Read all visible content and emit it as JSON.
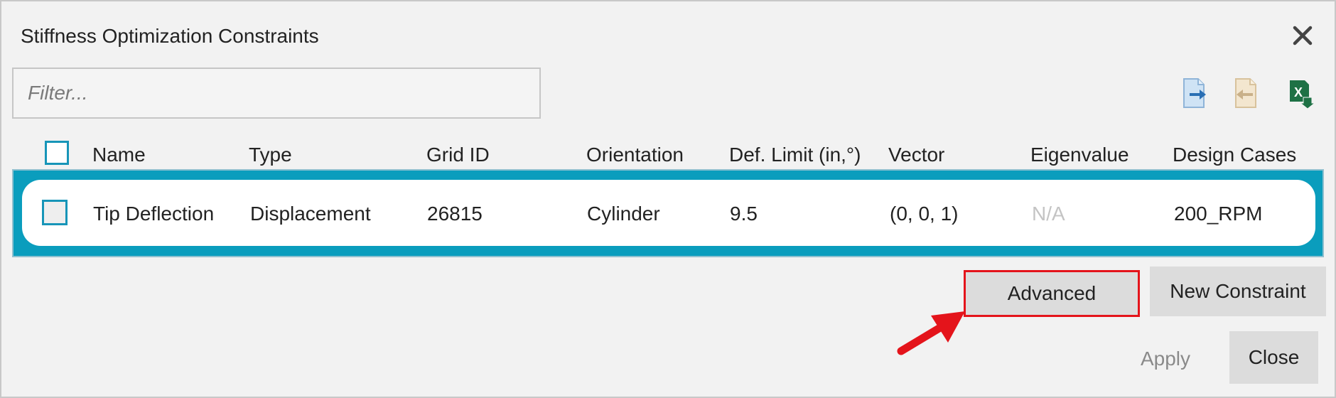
{
  "dialog": {
    "title": "Stiffness Optimization Constraints",
    "close_icon": "close-icon"
  },
  "filter": {
    "placeholder": "Filter...",
    "value": ""
  },
  "toolbar": {
    "icons": [
      "export-icon",
      "import-icon",
      "excel-export-icon"
    ]
  },
  "table": {
    "columns": [
      "Name",
      "Type",
      "Grid ID",
      "Orientation",
      "Def. Limit (in,°)",
      "Vector",
      "Eigenvalue",
      "Design Cases"
    ],
    "rows": [
      {
        "name": "Tip Deflection",
        "type": "Displacement",
        "grid_id": "26815",
        "orientation": "Cylinder",
        "def_limit": "9.5",
        "vector": "(0, 0, 1)",
        "eigenvalue": "N/A",
        "design_cases": "200_RPM",
        "selected": true
      }
    ]
  },
  "buttons": {
    "advanced": "Advanced",
    "new_constraint": "New Constraint",
    "apply": "Apply",
    "close": "Close"
  },
  "colors": {
    "accent": "#0a9dbd",
    "highlight": "#e4141b",
    "checkbox_border": "#1795b8"
  }
}
